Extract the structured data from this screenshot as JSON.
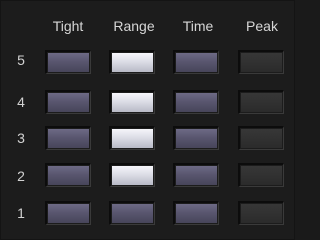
{
  "columns": [
    "Tight",
    "Range",
    "Time",
    "Peak"
  ],
  "rows": [
    {
      "label": "5",
      "states": [
        "dim",
        "bright",
        "dim",
        "off"
      ]
    },
    {
      "label": "4",
      "states": [
        "dim",
        "bright",
        "dim",
        "off"
      ]
    },
    {
      "label": "3",
      "states": [
        "dim",
        "bright",
        "dim",
        "off"
      ]
    },
    {
      "label": "2",
      "states": [
        "dim",
        "bright",
        "dim",
        "off"
      ]
    },
    {
      "label": "1",
      "states": [
        "dim",
        "dim",
        "dim",
        "off"
      ]
    }
  ],
  "colors": {
    "background": "#1c1c1c",
    "text": "#d6d6d6",
    "button_dim": "#59566f",
    "button_bright": "#dcdde6",
    "button_off": "#313131"
  }
}
